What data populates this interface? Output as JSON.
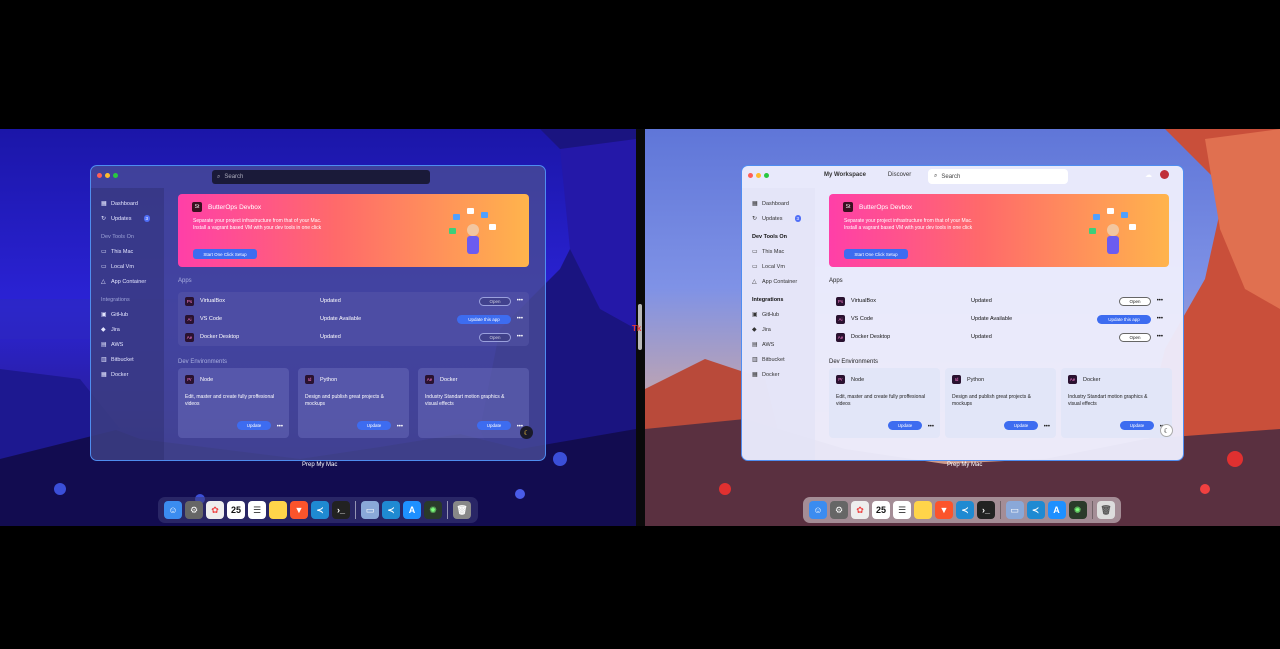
{
  "left": {
    "search": {
      "placeholder": "Search"
    },
    "caption": "Prep My Mac"
  },
  "right": {
    "tabs": [
      "My Workspace",
      "Discover"
    ],
    "search": {
      "placeholder": "Search"
    },
    "caption": "Prep My Mac"
  },
  "sidebar": {
    "dashboard": "Dashboard",
    "updates": "Updates",
    "updates_count": "3",
    "devtools_heading": "Dev Tools On",
    "this_mac": "This Mac",
    "local_vm": "Local Vm",
    "app_container": "App Container",
    "integrations_heading": "Integrations",
    "github": "GitHub",
    "jira": "Jira",
    "aws": "AWS",
    "bitbucket": "Bitbucket",
    "docker": "Docker"
  },
  "banner": {
    "logo": "St",
    "title": "ButterOps Devbox",
    "desc": "Separate your project infrastructure from that of your Mac. Install a vagrant based VM with your dev tools in one click",
    "cta": "Start One Click Setup"
  },
  "apps_section": "Apps",
  "apps": [
    {
      "icon": "Ps",
      "name": "VirtualBox",
      "status": "Updated",
      "button": "Open"
    },
    {
      "icon": "Ai",
      "name": "VS Code",
      "status": "Update Available",
      "button": "Update this app"
    },
    {
      "icon": "Ae",
      "name": "Docker Desktop",
      "status": "Updated",
      "button": "Open"
    }
  ],
  "dev_section": "Dev Environments",
  "dev_envs": [
    {
      "icon": "Pr",
      "name": "Node",
      "desc": "Edit, master and create fully proffesional videos",
      "button": "Update"
    },
    {
      "icon": "Id",
      "name": "Python",
      "desc": "Design and publish great projects & mockups",
      "button": "Update"
    },
    {
      "icon": "Ae",
      "name": "Docker",
      "desc": "Industry Standart motion graphics & visual effects",
      "button": "Update"
    }
  ],
  "more": "•••",
  "divider_tag": "Tk",
  "dock_icons": [
    "finder-icon",
    "launchpad-icon",
    "photos-icon",
    "calendar-icon",
    "reminders-icon",
    "notes-icon",
    "brave-icon",
    "vscode-icon",
    "terminal-icon",
    "preview-icon",
    "vscode-icon",
    "appstore-icon",
    "app-icon",
    "trash-icon"
  ],
  "calendar_day": "25",
  "colors": {
    "accent": "#3d6cf0",
    "window_border": "#4f8df0"
  }
}
